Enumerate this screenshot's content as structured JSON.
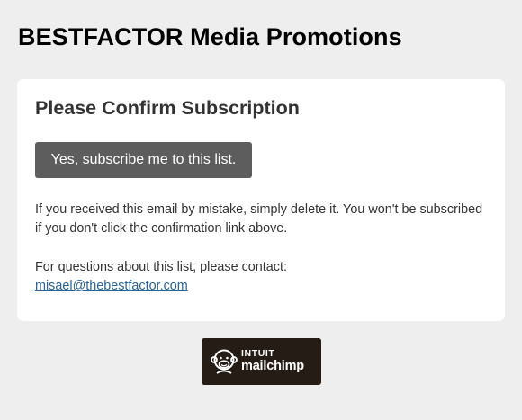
{
  "header": {
    "title": "BESTFACTOR Media Promotions"
  },
  "card": {
    "heading": "Please Confirm Subscription",
    "confirm_button_label": "Yes, subscribe me to this list.",
    "mistake_text": "If you received this email by mistake, simply delete it. You won't be subscribed if you don't click the confirmation link above.",
    "questions_text": "For questions about this list, please contact:",
    "contact_email": "misael@thebestfactor.com"
  },
  "footer": {
    "badge_line1": "INTUIT",
    "badge_line2": "mailchimp",
    "badge_icon": "freddie-monkey-icon"
  },
  "colors": {
    "page_background": "#eeeeee",
    "card_background": "#ffffff",
    "button_background": "#5d5d5d",
    "link": "#2a6496",
    "badge_background": "#241c15"
  }
}
